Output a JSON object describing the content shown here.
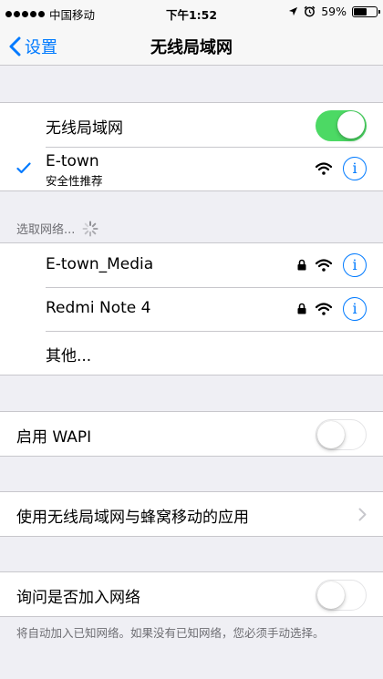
{
  "status_bar": {
    "carrier": "中国移动",
    "time": "下午1:52",
    "battery_percent": "59%",
    "battery_level": 0.59
  },
  "nav": {
    "back_label": "设置",
    "title": "无线局域网"
  },
  "wlan": {
    "label": "无线局域网",
    "enabled": true
  },
  "connected": {
    "name": "E-town",
    "subtitle": "安全性推荐"
  },
  "choose_header": "选取网络...",
  "networks": [
    {
      "name": "E-town_Media",
      "locked": true
    },
    {
      "name": "Redmi Note 4",
      "locked": true
    }
  ],
  "other_label": "其他...",
  "wapi": {
    "label": "启用 WAPI",
    "enabled": false
  },
  "apps_label": "使用无线局域网与蜂窝移动的应用",
  "ask": {
    "label": "询问是否加入网络",
    "enabled": false
  },
  "footer": "将自动加入已知网络。如果没有已知网络，您必须手动选择。",
  "colors": {
    "accent": "#007aff",
    "toggle_on": "#4cd964",
    "background": "#efeff4"
  }
}
